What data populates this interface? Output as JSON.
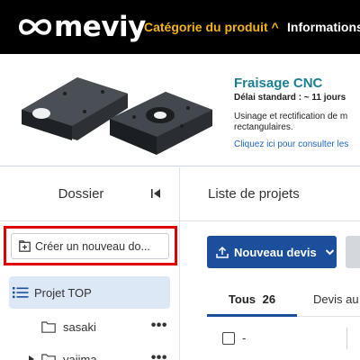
{
  "nav": {
    "logo_text": "meviy",
    "category_label": "Catégorie du produit ^",
    "info_label": "Informations"
  },
  "banner": {
    "title": "Fraisage CNC",
    "delay": "Délai standard : ~ 11 jours",
    "description": "Usinage et rectification de m rectangulaires.",
    "link": "Cliquez ici pour consulter les"
  },
  "sidebar": {
    "title": "Dossier",
    "create_button": "Créer un nouveau do...",
    "project_top": "Projet TOP",
    "folders": [
      {
        "label": "sasaki",
        "menu": "•••"
      },
      {
        "label": "yajima",
        "menu": "•••"
      }
    ]
  },
  "main": {
    "title": "Liste de projets",
    "new_quote_button": "Nouveau devis",
    "tabs": [
      {
        "label": "Tous",
        "count": "26"
      },
      {
        "label": "Devis au"
      }
    ],
    "first_row": {
      "value": "-"
    }
  },
  "colors": {
    "nav_bg": "#000000",
    "category_accent": "#f5b40a",
    "primary_button": "#1b4f9c",
    "banner_title": "#1a7f91",
    "selected_bg": "#dde8f7",
    "highlight_box": "#e00000"
  }
}
